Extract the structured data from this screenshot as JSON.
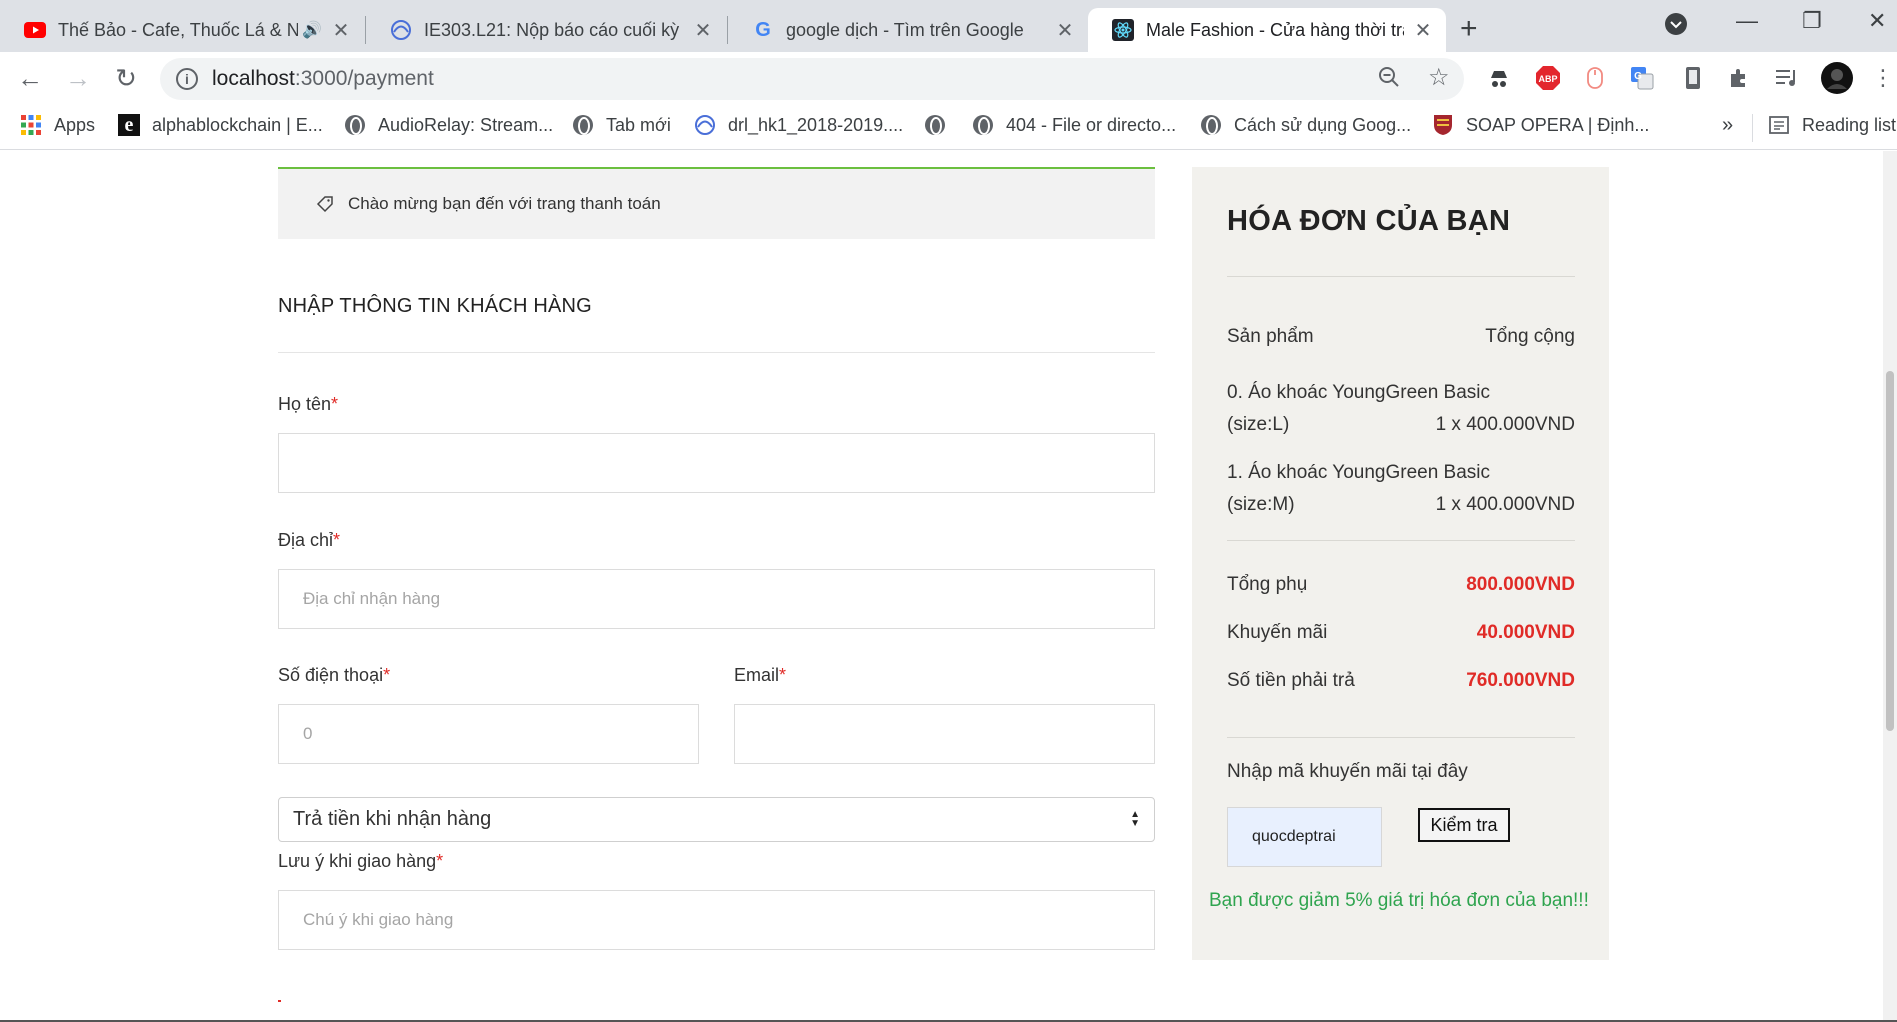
{
  "browser": {
    "tabs": [
      {
        "title": "Thế Bảo - Cafe, Thuốc Lá & N",
        "icon": "youtube-icon",
        "audio": true
      },
      {
        "title": "IE303.L21: Nộp báo cáo cuối kỳ",
        "icon": "moodle-icon"
      },
      {
        "title": "google dịch - Tìm trên Google",
        "icon": "google-icon"
      },
      {
        "title": "Male Fashion - Cửa hàng thời tra",
        "icon": "react-icon",
        "active": true
      }
    ],
    "new_tab": "+",
    "url_host": "localhost",
    "url_path": ":3000/payment",
    "bookmarks": [
      {
        "label": "Apps",
        "icon": "apps-grid-icon"
      },
      {
        "label": "alphablockchain | E...",
        "icon": "e-logo-icon"
      },
      {
        "label": "AudioRelay: Stream...",
        "icon": "globe-icon"
      },
      {
        "label": "Tab mới",
        "icon": "globe-icon"
      },
      {
        "label": "drl_hk1_2018-2019....",
        "icon": "moodle-icon"
      },
      {
        "label": "",
        "icon": "globe-icon"
      },
      {
        "label": "404 - File or directo...",
        "icon": "globe-icon"
      },
      {
        "label": "Cách sử dụng Goog...",
        "icon": "globe-icon"
      },
      {
        "label": "SOAP OPERA | Định...",
        "icon": "crest-icon"
      }
    ],
    "more_bookmarks": "»",
    "reading_list": "Reading list"
  },
  "page": {
    "notice": "Chào mừng bạn đến với trang thanh toán",
    "section_title": "NHẬP THÔNG TIN KHÁCH HÀNG",
    "fields": {
      "name_label": "Họ tên",
      "name_value": "",
      "address_label": "Địa chỉ",
      "address_placeholder": "Địa chỉ nhận hàng",
      "phone_label": "Số điện thoại",
      "phone_placeholder": "0",
      "email_label": "Email",
      "email_value": "",
      "required_mark": "*",
      "payment_method": "Trả tiền khi nhận hàng",
      "note_label": "Lưu ý khi giao hàng",
      "note_placeholder": "Chú ý khi giao hàng"
    },
    "colors": {
      "accent_green": "#6bbf3f",
      "price_red": "#e02b27",
      "success_green": "#2fa44f"
    }
  },
  "invoice": {
    "title": "HÓA ĐƠN CỦA BẠN",
    "header_product": "Sản phẩm",
    "header_total": "Tổng cộng",
    "items": [
      {
        "name": "0. Áo khoác YoungGreen Basic",
        "size": "(size:L)",
        "qty_price": "1 x 400.000VND"
      },
      {
        "name": "1. Áo khoác YoungGreen Basic",
        "size": "(size:M)",
        "qty_price": "1 x 400.000VND"
      }
    ],
    "subtotal_label": "Tổng phụ",
    "subtotal": "800.000VND",
    "discount_label": "Khuyến mãi",
    "discount": "40.000VND",
    "total_label": "Số tiền phải trả",
    "total": "760.000VND",
    "promo_label": "Nhập mã khuyến mãi tại đây",
    "promo_code": "quocdeptrai",
    "check_button": "Kiểm tra",
    "promo_message": "Bạn được giảm 5% giá trị hóa đơn của bạn!!!"
  }
}
